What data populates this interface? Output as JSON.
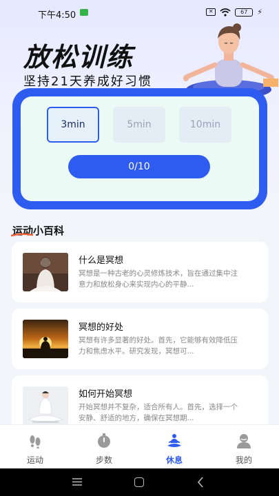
{
  "status_bar": {
    "time": "下午4:50",
    "battery": "67"
  },
  "hero": {
    "title": "放松训练",
    "subtitle": "坚持21天养成好习惯"
  },
  "durations": [
    {
      "label": "3min",
      "selected": true
    },
    {
      "label": "5min",
      "selected": false
    },
    {
      "label": "10min",
      "selected": false
    }
  ],
  "progress": {
    "label": "0/10",
    "done": 0,
    "total": 10
  },
  "section": {
    "title": "运动小百科"
  },
  "articles": [
    {
      "title": "什么是冥想",
      "desc": "冥想是一种古老的心灵修炼技术，旨在通过集中注意力和放松身心来实现内心的平静..."
    },
    {
      "title": "冥想的好处",
      "desc": "冥想有许多显著的好处。首先，它能够有效降低压力和焦虑水平。研究发现，冥想可..."
    },
    {
      "title": "如何开始冥想",
      "desc": "开始冥想并不复杂，适合所有人。首先，选择一个安静、舒适的地方，确保在冥想期..."
    }
  ],
  "tabs": [
    {
      "label": "运动",
      "icon": "footprints-icon",
      "active": false
    },
    {
      "label": "步数",
      "icon": "stopwatch-icon",
      "active": false
    },
    {
      "label": "休息",
      "icon": "meditation-icon",
      "active": true
    },
    {
      "label": "我的",
      "icon": "profile-icon",
      "active": false
    }
  ],
  "colors": {
    "accent": "#2f5cf0",
    "card_inner": "#ecfaf6",
    "background": "#f4f5fb"
  }
}
